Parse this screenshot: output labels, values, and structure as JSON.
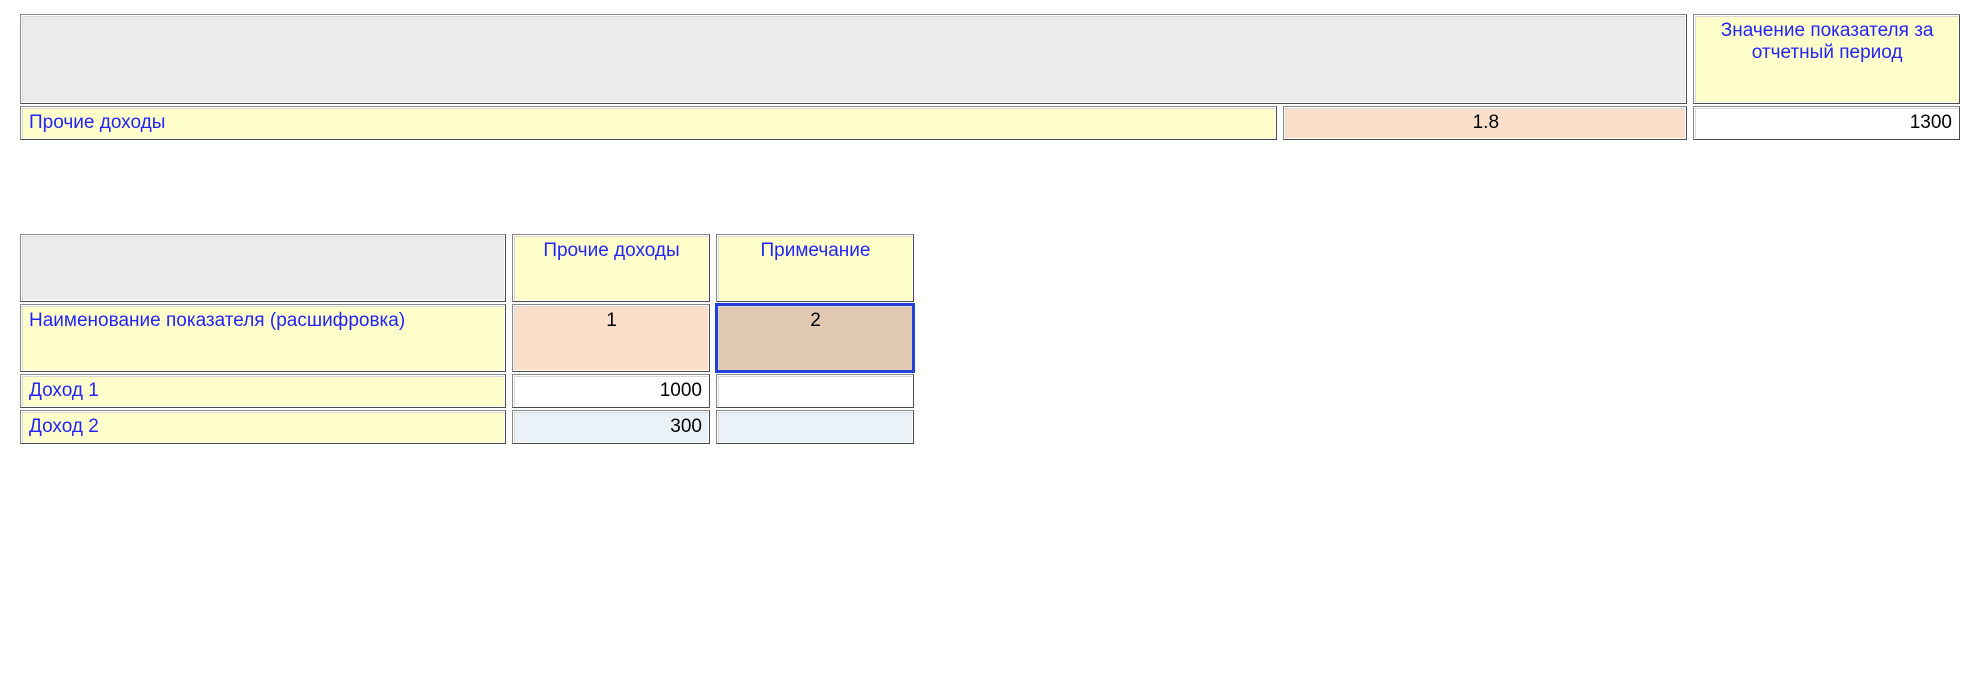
{
  "top": {
    "value_header": "Значение показателя за отчетный период",
    "row_label": "Прочие доходы",
    "row_index": "1.8",
    "row_value": "1300"
  },
  "detail": {
    "blank_header": "",
    "col1_header": "Прочие доходы",
    "col2_header": "Примечание",
    "sub_label": "Наименование показателя (расшифровка)",
    "sub_col1": "1",
    "sub_col2": "2",
    "rows": [
      {
        "label": "Доход 1",
        "col1": "1000",
        "col2": ""
      },
      {
        "label": "Доход 2",
        "col1": "300",
        "col2": ""
      }
    ]
  }
}
